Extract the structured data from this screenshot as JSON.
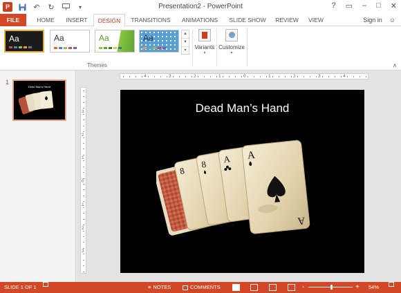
{
  "titlebar": {
    "title": "Presentation2 - PowerPoint",
    "help_label": "?",
    "qat_icons": [
      "powerpoint-logo-icon",
      "save-icon",
      "undo-icon",
      "redo-icon",
      "start-slideshow-icon",
      "customize-qat-icon"
    ]
  },
  "tabs": [
    {
      "label": "FILE"
    },
    {
      "label": "HOME"
    },
    {
      "label": "INSERT"
    },
    {
      "label": "DESIGN"
    },
    {
      "label": "TRANSITIONS"
    },
    {
      "label": "ANIMATIONS"
    },
    {
      "label": "SLIDE SHOW"
    },
    {
      "label": "REVIEW"
    },
    {
      "label": "VIEW"
    }
  ],
  "active_tab": "DESIGN",
  "account": {
    "signin_label": "Sign in"
  },
  "ribbon": {
    "themes": [
      {
        "label": "Aa",
        "colors": [
          "#c0504d",
          "#4f81bd",
          "#9bbb59",
          "#f79646",
          "#8064a2"
        ]
      },
      {
        "label": "Aa",
        "colors": [
          "#e46c0a",
          "#4f81bd",
          "#9bbb59",
          "#c0504d",
          "#8064a2"
        ]
      },
      {
        "label": "Aa",
        "colors": [
          "#8cc63f",
          "#5da336",
          "#3b7a1f",
          "#c0d86a",
          "#2f6f8f"
        ]
      },
      {
        "label": "Aa",
        "colors": [
          "#f79646",
          "#4bacc6",
          "#9bbb59",
          "#c0504d",
          "#8064a2"
        ]
      }
    ],
    "themes_group_label": "Themes",
    "variants_label": "Variants",
    "customize_label": "Customize"
  },
  "thumbnail": {
    "number": "1",
    "title": "Dead Man's Hand"
  },
  "slide": {
    "title": "Dead Man’s Hand"
  },
  "ruler": {
    "h_labels": [
      "4",
      "3",
      "2",
      "1",
      "0",
      "1",
      "2",
      "3",
      "4"
    ],
    "v_labels": [
      "3",
      "2",
      "1",
      "0",
      "1",
      "2",
      "3"
    ]
  },
  "status": {
    "slide_info": "SLIDE 1 OF 1",
    "notes_label": "NOTES",
    "comments_label": "COMMENTS",
    "zoom_minus": "-",
    "zoom_plus": "+",
    "zoom_level": "54%",
    "zoom_fraction": 0.54
  },
  "colors": {
    "accent": "#d24726",
    "slide_bg": "#000000"
  }
}
